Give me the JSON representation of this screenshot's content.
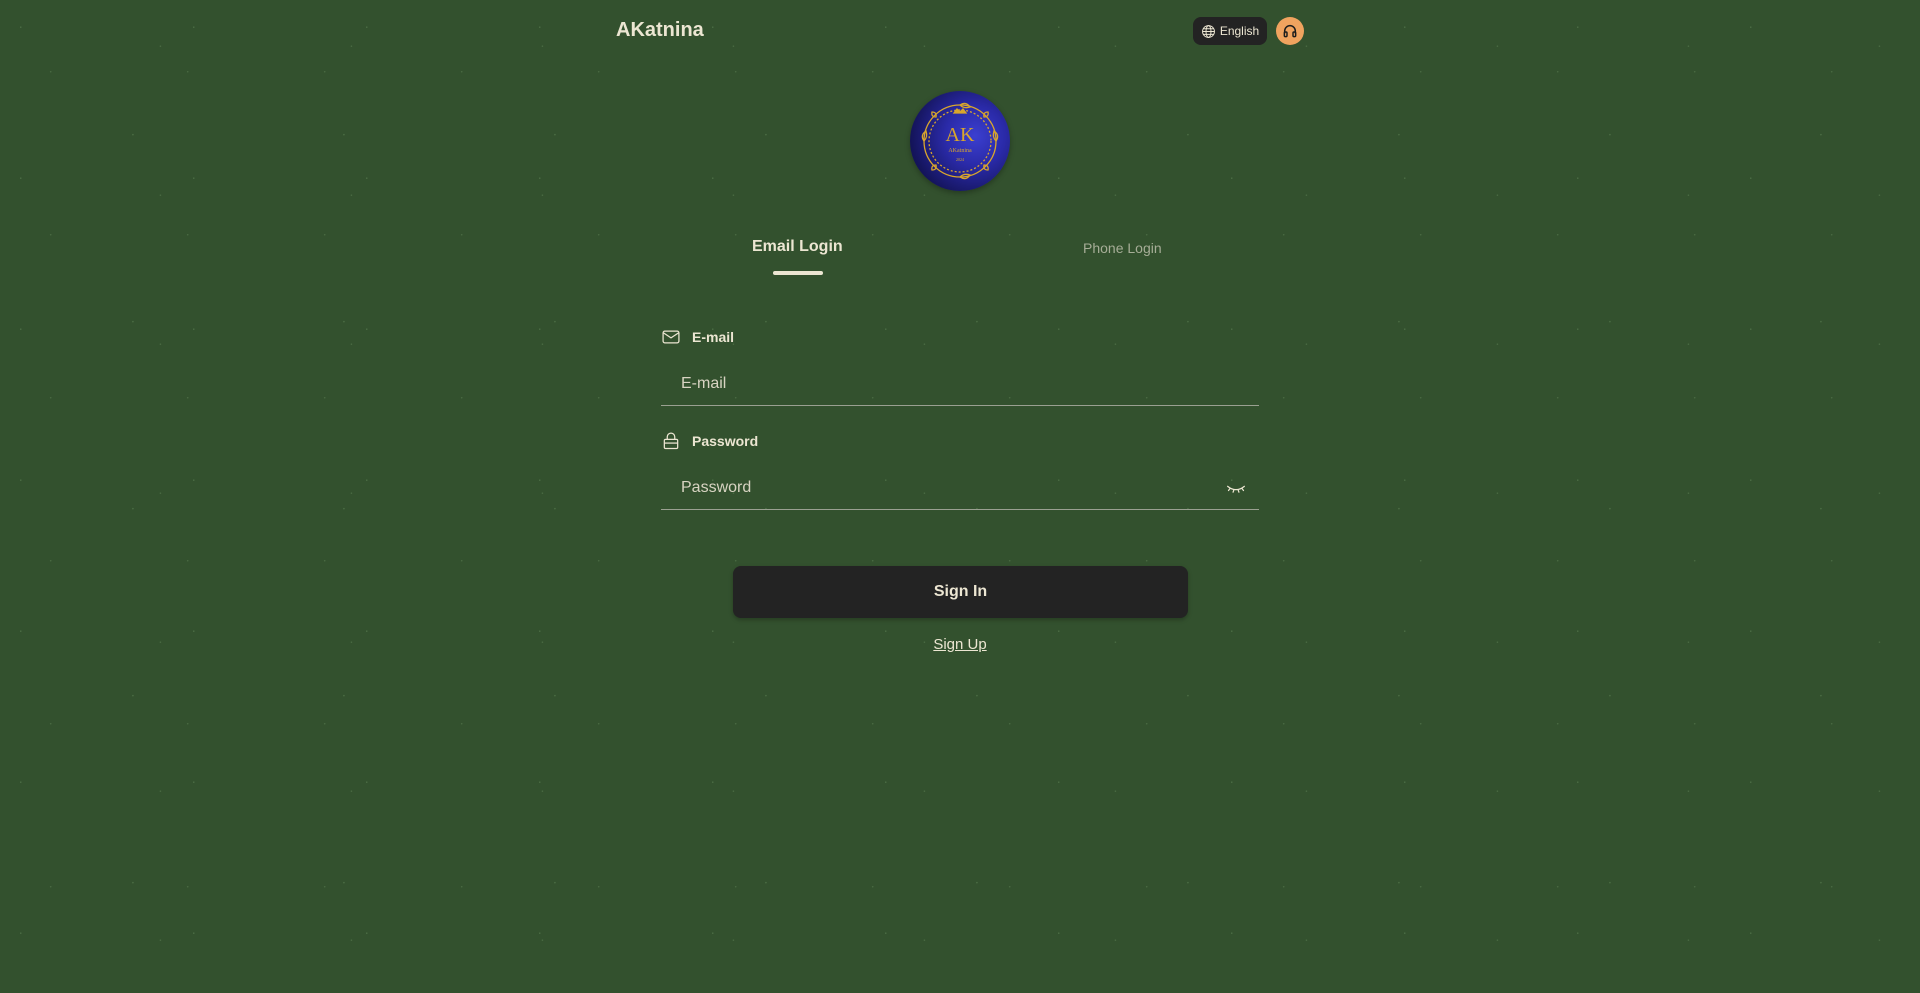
{
  "header": {
    "app_title": "AKatnina",
    "language_label": "English"
  },
  "logo": {
    "monogram": "AK",
    "brand_text": "AKatnina",
    "year_text": "2024"
  },
  "tabs": [
    {
      "label": "Email Login",
      "active": true
    },
    {
      "label": "Phone Login",
      "active": false
    }
  ],
  "form": {
    "email": {
      "label": "E-mail",
      "placeholder": "E-mail",
      "value": ""
    },
    "password": {
      "label": "Password",
      "placeholder": "Password",
      "value": ""
    }
  },
  "actions": {
    "sign_in_label": "Sign In",
    "sign_up_label": "Sign Up"
  },
  "colors": {
    "background": "#33512e",
    "button_dark": "#232323",
    "support_accent": "#f0a35f",
    "text_light": "#ece6d2",
    "logo_gold": "#d9a62c"
  },
  "icons": {
    "language": "globe-icon",
    "support": "headphones-icon",
    "email": "envelope-icon",
    "password": "lock-icon",
    "visibility": "eye-closed-icon"
  }
}
